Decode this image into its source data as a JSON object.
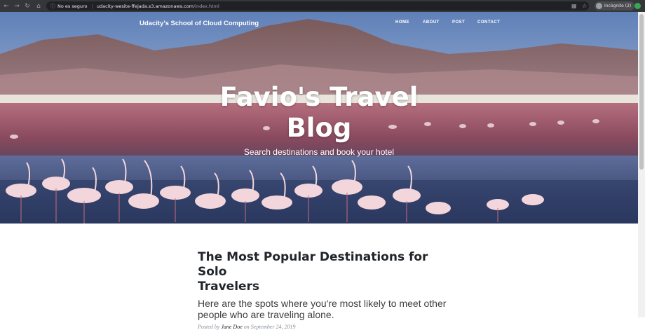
{
  "browser": {
    "security_label": "No es seguro",
    "url_host": "udacity-wesite-ffejada.s3.amazonaws.com",
    "url_path": "/index.html",
    "incognito_label": "Incógnito (2)",
    "icons": [
      "back-icon",
      "forward-icon",
      "reload-icon",
      "home-icon",
      "info-icon",
      "translate-icon",
      "star-icon",
      "extension-icon"
    ]
  },
  "header": {
    "brand": "Udacity's School of Cloud Computing",
    "menu": [
      "HOME",
      "ABOUT",
      "POST",
      "CONTACT"
    ],
    "title_line1": "Favio's Travel",
    "title_line2": "Blog",
    "subtitle": "Search destinations and book your hotel"
  },
  "post": {
    "title_line1": "The Most Popular Destinations for Solo",
    "title_line2": "Travelers",
    "subtitle_line1": "Here are the spots where you're most likely to meet other",
    "subtitle_line2": "people who are traveling alone.",
    "posted_by": "Posted by",
    "author": "Jane Doe",
    "on": "on",
    "date": "September 24, 2019"
  },
  "colors": {
    "chrome_bg": "#35363a",
    "omnibox_bg": "#202124",
    "text_dark": "#212529",
    "meta_gray": "#868e96"
  }
}
